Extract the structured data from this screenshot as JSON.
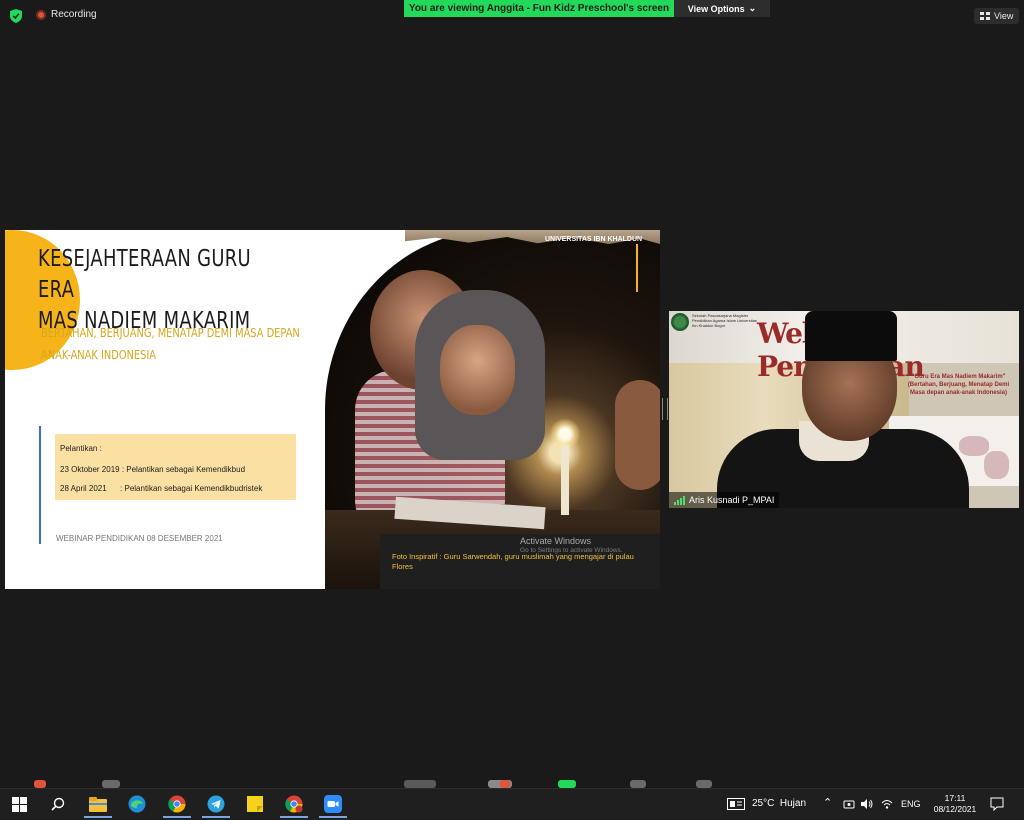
{
  "topbar": {
    "recording_label": "Recording",
    "share_banner": "You are viewing Anggita - Fun Kidz Preschool's screen",
    "view_options_label": "View Options",
    "view_label": "View"
  },
  "slide": {
    "title_line1": "KESEJAHTERAAN GURU ERA",
    "title_line2": "MAS NADIEM MAKARIM",
    "subtitle_line1": "BERTAHAN, BERJUANG, MENATAP DEMI MASA DEPAN",
    "subtitle_line2": "ANAK-ANAK INDONESIA",
    "box_heading": "Pelantikan :",
    "box_line1": "23 Oktober 2019 : Pelantikan sebagai Kemendikbud",
    "box_line2": "28 April 2021      : Pelantikan sebagai Kemendikbudristek",
    "footer": "WEBINAR PENDIDIKAN 08 DESEMBER 2021",
    "university": "UNIVERSITAS IBN KHALDUN",
    "caption": "Foto Inspiratif : Guru Sarwendah, guru muslimah yang mengajar di pulau Flores",
    "activate_title": "Activate Windows",
    "activate_sub": "Go to Settings to activate Windows."
  },
  "participant": {
    "name": "Aris Kusnadi P_MPAI",
    "banner_title": "Webinar Pendidikan",
    "banner_org": "Sekolah Pascasarjana Magister Pendidikan Agama Islam Universitas Ibn Khaldun Bogor",
    "banner_sub": "\"Guru Era Mas Nadiem Makarim\" (Bertahan, Berjuang, Menatap Demi Masa depan anak-anak Indonesia)"
  },
  "taskbar": {
    "weather": "25°C  Hujan",
    "language": "ENG",
    "time": "17:11",
    "date": "08/12/2021"
  },
  "colors": {
    "share_green": "#23d959",
    "slide_gold": "#f6b41a",
    "slide_blue": "#2f6fd6",
    "taskbar_bg": "#1f1f1f"
  }
}
